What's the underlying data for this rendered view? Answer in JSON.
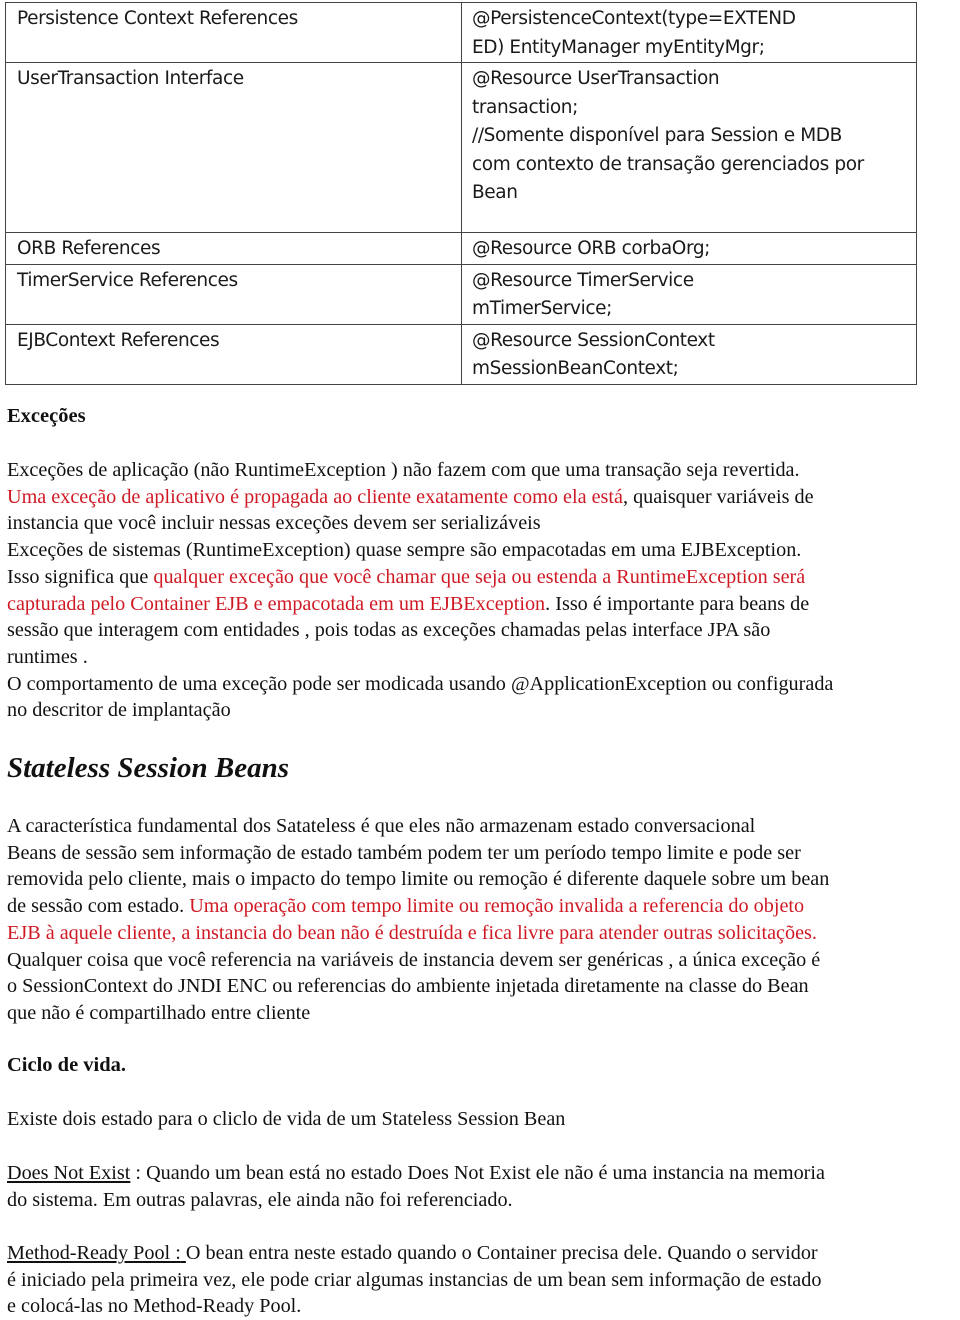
{
  "table": {
    "rows": [
      {
        "label": "Persistence Context References",
        "code": [
          "@PersistenceContext(type=EXTEND",
          "ED) EntityManager myEntityMgr;"
        ]
      },
      {
        "label": "UserTransaction Interface",
        "code": [
          "@Resource UserTransaction",
          "transaction;",
          "//Somente disponível para Session e MDB",
          "com contexto de transação gerenciados por",
          "Bean"
        ]
      },
      {
        "label": "ORB References",
        "code": [
          "@Resource ORB corbaOrg;"
        ]
      },
      {
        "label": "TimerService References",
        "code": [
          "@Resource TimerService",
          "mTimerService;"
        ]
      },
      {
        "label": "EJBContext References",
        "code": [
          "@Resource SessionContext",
          "mSessionBeanContext;"
        ]
      }
    ]
  },
  "excecoes": {
    "heading": "Exceções",
    "l1": "Exceções de aplicação (não RuntimeException ) não fazem com que uma transação seja revertida.",
    "l2_red": "Uma exceção de aplicativo é propagada ao cliente exatamente como ela está",
    "l2_black": ", quaisquer variáveis de",
    "l3": "instancia que você incluir nessas exceções devem ser serializáveis",
    "l4": "Exceções de sistemas (RuntimeException)  quase sempre são empacotadas em uma EJBException.",
    "l5_black": "Isso significa que ",
    "l5_red": "qualquer exceção que você chamar que seja ou estenda a RuntimeException será",
    "l6_red": "capturada pelo Container EJB e empacotada em um EJBException",
    "l6_black": ". Isso é importante para beans de",
    "l7": "sessão que interagem com entidades , pois todas as exceções chamadas pelas interface JPA são",
    "l8": "runtimes .",
    "l9": "O comportamento de uma exceção pode ser modicada usando @ApplicationException ou configurada",
    "l10": "no descritor de implantação"
  },
  "stateless": {
    "title": "Stateless Session Beans",
    "l1": "A característica fundamental dos Satateless é que eles não armazenam estado conversacional",
    "l2": "Beans de sessão sem informação de estado também podem ter um período tempo limite  e pode ser",
    "l3": "removida pelo cliente, mais o impacto do tempo limite ou remoção é diferente daquele sobre um bean",
    "l4_black": "de sessão com estado. ",
    "l4_red": "Uma operação com tempo limite ou remoção invalida a referencia do objeto",
    "l5_red": "EJB à aquele cliente, a instancia do bean não é destruída e fica livre para atender outras solicitações.",
    "l6": "Qualquer coisa que você referencia na variáveis de instancia devem ser genéricas , a única exceção é",
    "l7": "o SessionContext  do JNDI ENC ou referencias do ambiente injetada diretamente na classe do Bean",
    "l8": "que não é compartilhado entre cliente"
  },
  "ciclo": {
    "heading": "Ciclo de vida.",
    "intro": "Existe dois estado para o cliclo de vida de um Stateless Session Bean",
    "dne_term": "Does Not Exist",
    "dne_l1": " : Quando um bean está no estado Does Not Exist ele não é uma instancia na memoria",
    "dne_l2": "do sistema. Em outras palavras, ele ainda não foi referenciado.",
    "mrp_term": "Method-Ready Pool :",
    "mrp_sep": " ",
    "mrp_l1": " O bean entra neste estado quando o Container precisa dele. Quando o servidor",
    "mrp_l2": "é iniciado pela primeira vez, ele pode criar algumas instancias de um bean sem informação de estado",
    "mrp_l3": "e colocá-las no Method-Ready Pool."
  },
  "colors": {
    "accent_red": "#cf1a24",
    "text": "#111111",
    "table_border": "#444444"
  }
}
